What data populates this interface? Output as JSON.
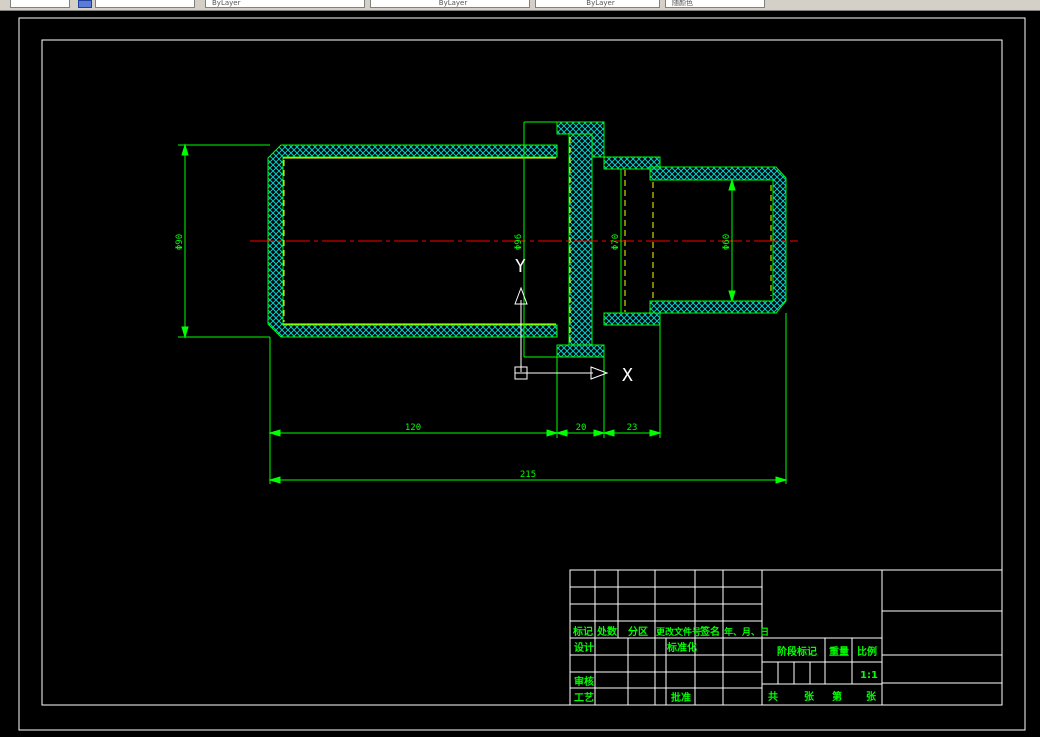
{
  "toolbar": {
    "layer_items": [
      "ByLayer",
      "ByLayer",
      "ByLayer"
    ],
    "style_label": "随颜色"
  },
  "drawing": {
    "dimensions": {
      "d90": "Φ90",
      "d96": "Φ96",
      "d70": "Φ70",
      "d60": "Φ60",
      "len120": "120",
      "len20": "20",
      "len23": "23",
      "len215": "215"
    },
    "ucs": {
      "x_label": "X",
      "y_label": "Y"
    }
  },
  "title_block": {
    "labels": {
      "mark": "标记",
      "count": "处数",
      "zone": "分区",
      "doc_no": "更改文件号",
      "sign": "签名",
      "date": "年、月、日",
      "design": "设计",
      "standard": "标准化",
      "review": "审核",
      "process": "工艺",
      "approve": "批准",
      "stage": "阶段标记",
      "weight": "重量",
      "scale": "比例",
      "scale_value": "1:1",
      "total": "共",
      "sheets": "张",
      "page": "第",
      "sheet2": "张"
    }
  },
  "colors": {
    "background": "#000000",
    "outline": "#00ff00",
    "hatch": "#00cccc",
    "center_line": "#ff0000",
    "hidden_line": "#ffff00",
    "frame": "#ffffff"
  }
}
